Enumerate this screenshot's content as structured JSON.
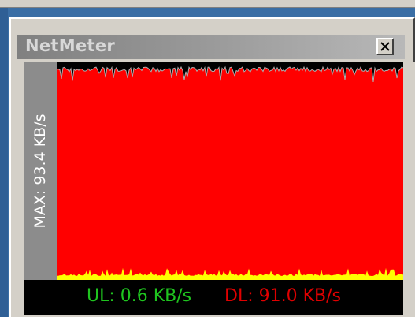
{
  "window": {
    "title": "NetMeter",
    "close_icon": "close-icon"
  },
  "meter": {
    "max_label": "MAX: 93.4 KB/s",
    "upload_label": "UL: 0.6 KB/s",
    "download_label": "DL: 91.0 KB/s"
  },
  "colors": {
    "desktop": "#3a6ea5",
    "download_fill": "#ff0000",
    "upload_fill": "#ffff00",
    "graph_background": "#000000",
    "upload_text": "#1fc41f",
    "download_text": "#e00000",
    "titlebar_text": "#d8d8d8"
  }
}
